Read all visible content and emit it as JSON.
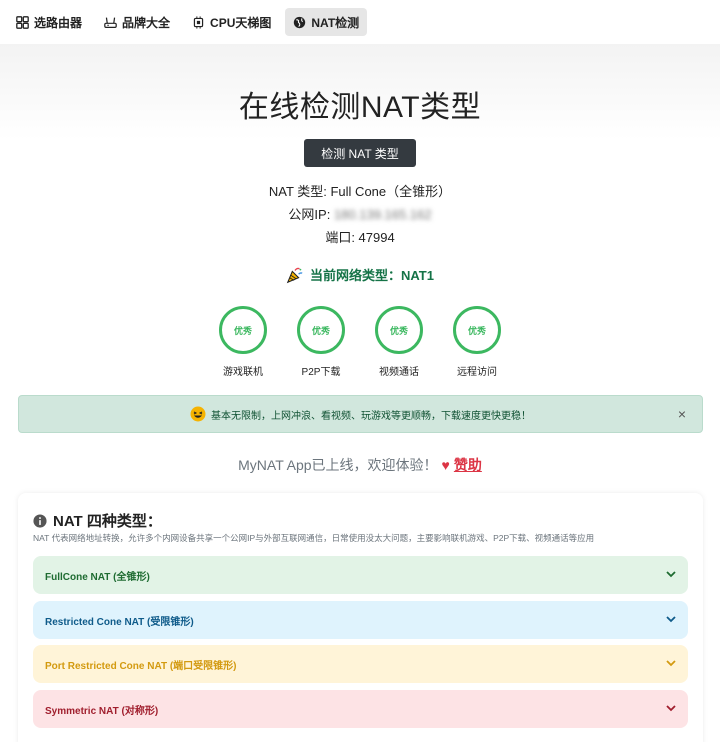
{
  "nav": {
    "items": [
      {
        "label": "选路由器",
        "icon": "grid-icon"
      },
      {
        "label": "品牌大全",
        "icon": "router-icon"
      },
      {
        "label": "CPU天梯图",
        "icon": "cpu-icon"
      },
      {
        "label": "NAT检测",
        "icon": "globe-icon"
      }
    ]
  },
  "hero": {
    "title": "在线检测NAT类型",
    "detect_button": "检测 NAT 类型"
  },
  "result": {
    "nat_type": "NAT 类型: Full Cone（全锥形）",
    "public_ip_label": "公网IP:",
    "public_ip_value": "180.139.165.162",
    "port": "端口: 47994",
    "network_type": "当前网络类型：NAT1"
  },
  "scores": [
    {
      "rating": "优秀",
      "label": "游戏联机"
    },
    {
      "rating": "优秀",
      "label": "P2P下载"
    },
    {
      "rating": "优秀",
      "label": "视频通话"
    },
    {
      "rating": "优秀",
      "label": "远程访问"
    }
  ],
  "alert": {
    "text": "基本无限制，上网冲浪、看视频、玩游戏等更顺畅，下载速度更快更稳！",
    "close": "×"
  },
  "promo": {
    "text": "MyNAT App已上线，欢迎体验！",
    "sponsor": "赞助"
  },
  "card": {
    "title": "NAT 四种类型：",
    "description": "NAT 代表网络地址转换，允许多个内网设备共享一个公网IP与外部互联网通信，日常使用没太大问题，主要影响联机游戏、P2P下载、视频通话等应用",
    "accordions": [
      {
        "label": "FullCone NAT (全锥形)"
      },
      {
        "label": "Restricted Cone NAT (受限锥形)"
      },
      {
        "label": "Port Restricted Cone NAT (端口受限锥形)"
      },
      {
        "label": "Symmetric NAT (对称形)"
      }
    ]
  },
  "colors": {
    "accent_green": "#3cb860",
    "button_dark": "#343a40",
    "sponsor_red": "#dc3545"
  }
}
